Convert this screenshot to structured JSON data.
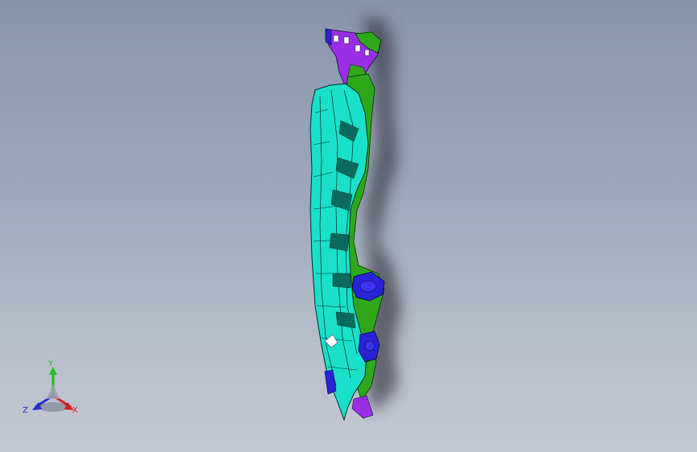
{
  "viewport": {
    "background_top": "#8795ab",
    "background_bottom": "#c3c8d2"
  },
  "model": {
    "colors": {
      "cyan": "#19e0c8",
      "green": "#2ea81a",
      "purple": "#9a2ee6",
      "blue": "#2a22d8",
      "edge": "#0a2a24"
    }
  },
  "triad": {
    "y_label": "Y",
    "x_label": "X",
    "z_label": "Z",
    "y_color": "#1fbf1f",
    "x_color": "#d42020",
    "z_color": "#2030d0"
  }
}
